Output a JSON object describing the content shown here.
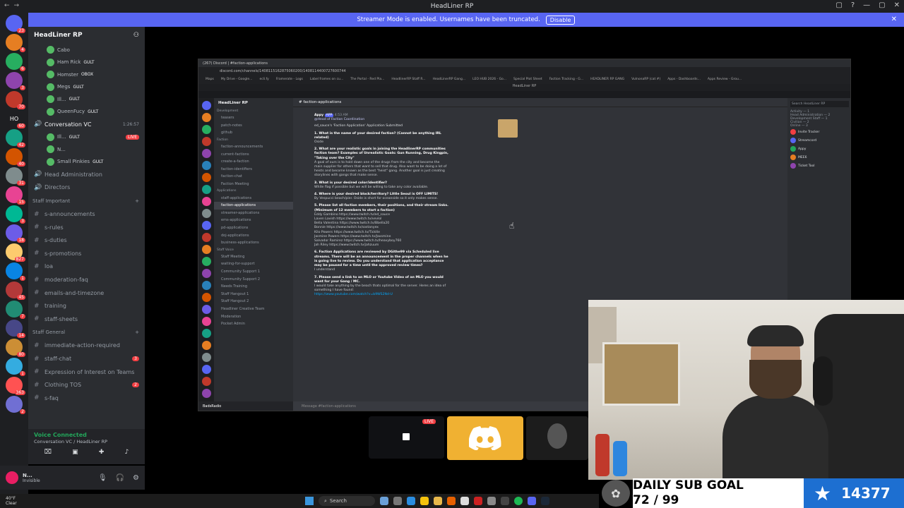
{
  "window": {
    "title": "HeadLiner RP",
    "nav": [
      "←",
      "→"
    ],
    "controls": [
      "▢",
      "?",
      "—",
      "▢",
      "✕"
    ]
  },
  "streamer_banner": {
    "text": "Streamer Mode is enabled. Usernames have been truncated.",
    "button": "Disable"
  },
  "guilds": {
    "badges": [
      "23",
      "4",
      "6",
      "3",
      "70",
      "60",
      "42",
      "40",
      "31",
      "15",
      "3",
      "18",
      "827",
      "1",
      "45",
      "7",
      "14",
      "80",
      "1",
      "363",
      "2"
    ],
    "home_label": "HO"
  },
  "server": {
    "name": "HeadLiner RP",
    "voice_users": [
      "Cabo",
      "Ham Rick",
      "Homster",
      "Megs",
      "Ill...",
      "QueenFucy"
    ],
    "voice_tags": [
      "",
      "GULT",
      "OBOX",
      "GULT",
      "GULT",
      "GULT"
    ],
    "voice_channel": "Conversation VC",
    "voice_channel_time": "1:26:57",
    "conv_users": [
      "Ill...",
      "N...",
      "Small Pinkies"
    ],
    "conv_tags": [
      "GULT",
      "",
      "GULT"
    ],
    "live_label": "LIVE",
    "channels_top": [
      "Head Administration",
      "Directors"
    ],
    "category_staff_important": "Staff Important",
    "staff_channels": [
      {
        "name": "s-announcements",
        "badge": ""
      },
      {
        "name": "s-rules",
        "badge": ""
      },
      {
        "name": "s-duties",
        "badge": ""
      },
      {
        "name": "s-promotions",
        "badge": ""
      },
      {
        "name": "loa",
        "badge": ""
      },
      {
        "name": "moderation-faq",
        "badge": ""
      },
      {
        "name": "emails-and-timezone",
        "badge": ""
      },
      {
        "name": "training",
        "badge": ""
      },
      {
        "name": "staff-sheets",
        "badge": ""
      }
    ],
    "category_staff_general": "Staff General",
    "general_channels": [
      {
        "name": "immediate-action-required",
        "badge": ""
      },
      {
        "name": "staff-chat",
        "badge": "3"
      },
      {
        "name": "Expression of Interest on Teams",
        "badge": ""
      },
      {
        "name": "Clothing TOS",
        "badge": "2"
      },
      {
        "name": "s-faq",
        "badge": ""
      }
    ]
  },
  "voice_status": {
    "title": "Voice Connected",
    "subtitle": "Conversation VC / HeadLiner RP"
  },
  "user": {
    "name": "N...",
    "status": "Invisible"
  },
  "shared_screen": {
    "tab_title": "(267) Discord | #faction-applications",
    "address": "discord.com/channels/1408115162875060200/1408114400727600744",
    "bookmarks": [
      "Maps",
      "My Drive - Google...",
      "ecli.fy",
      "Framerate - Logs",
      "Label frames on cu...",
      "The Portal - Red Pla...",
      "HeadlinerRP Staff R...",
      "HeadLinerRP Gang...",
      "LEO HUB 2026 - Go...",
      "Special Plot Sheet",
      "Faction Tracking - G...",
      "HEADLINER RP GANG",
      "VulnonaRP (cat #)",
      "Apps - Dashboards...",
      "Apps Review - Grou..."
    ],
    "window_label": "HeadLiner RP",
    "server_name": "HeadLiner RP",
    "channel_name": "faction-applications",
    "categories": [
      "Development",
      "Faction",
      "Applications",
      "Staff Voice"
    ],
    "dev_channels": [
      "teasers",
      "patch-notes",
      "github"
    ],
    "faction_channels": [
      "faction-announcements",
      "current-factions",
      "create-a-faction",
      "faction-identifiers",
      "faction-chat",
      "Faction Meeting"
    ],
    "app_channels": [
      "staff-applications",
      "faction-applications",
      "streamer-applications",
      "ems-applications",
      "pd-applications",
      "doj-applications",
      "business-applications"
    ],
    "voice_channels": [
      "Staff Meeting",
      "waiting-for-support",
      "Community Support 1",
      "Community Support 2",
      "Needs Training",
      "Staff Hangout 1",
      "Staff Hangout 2",
      "Headliner Creative Team",
      "Moderation",
      "Pocket Admin"
    ],
    "message": {
      "author": "Appy",
      "bot_tag": "APP",
      "time": "4:53 AM",
      "role_ping": "@Head of Faction Coordination",
      "header": "ed_sauce's 'Faction Application' Application Submitted",
      "q1": "1. What is the name of your desired faction? (Cannot be anything IRL related)",
      "a1": "Oside",
      "q2": "2. What are your realistic goals in joining the HeadlinerRP communities faction team? Examples of Unrealistic Goals: Gun Running, Drug Kingpin, \"Taking over the City\"",
      "a2": "A goal of ours is to hold down one of the drugs from the city and become the main supplier for others that want to sell that drug. Also want to be doing a lot of heists and become known as the best \"heist\" gang. Another goal is just creating storylines with gangs that make sense.",
      "q3": "3. What is your desired color/identifier?",
      "a3": "White flag if possible but we will be willing to take any color available.",
      "q4": "4. Where is your desired block/territory? Little Seoul is OFF LIMITS!",
      "a4": "By Vespucci beach/pier. Oside is short for oceanside so it only makes sense.",
      "q5": "5. Please list all faction members, their positions, and their stream links. (Minimum of 12 members to start a faction)",
      "a5": [
        "Eddy Gambino https://www.twitch.tv/ed_sauce",
        "Laven Lavish https://www.twitch.tv/vevlol",
        "Bella Valentina https://www.twitch.tv/Bbella20",
        "Bonnie https://www.twitch.tv/sostanyex",
        "Kilo Powers https://www.twitch.tv/Ticktle",
        "Jasmine Powers https://www.twitch.tv/Jaxsmine",
        "Salvador Ramirez https://www.twitch.tv/heavyboy760",
        "Jah Riley https://www.twitch.tv/jahzuum"
      ],
      "q6": "6. Faction Applications are reviewed by DGithe99 via Scheduled live streams. There will be an announcement in the proper channels when he is going live to review. Do you understand that application acceptance may be paused for a time until the approved review times?",
      "a6": "I understand",
      "q7": "7. Please send a link to an MLO or Youtube Video of an MLO you would want for your Gang / MC.",
      "a7": "I would take anything by the beach thats optimal for the server. Heres an idea of something I have found:",
      "a7link": "https://www.youtube.com/watch?v=b9WS2Nd-U"
    },
    "input_placeholder": "Message #faction-applications",
    "search_placeholder": "Search HeadLiner RP",
    "member_groups": [
      "Activity — 1",
      "Head Administration — 2",
      "Development Staff — 1",
      "Civilian — 2",
      "Online — 3"
    ],
    "members": [
      "Invite Tracker",
      "Streamcord",
      "Appy",
      "MEE6",
      "Ticket Tool"
    ],
    "user_label": "BadsRadio"
  },
  "stream_tiles": {
    "live_label": "LIVE"
  },
  "sub_goal": {
    "title": "DAILY SUB GOAL",
    "progress": "72 / 99",
    "current": 72,
    "target": 99,
    "count": "14377"
  },
  "taskbar": {
    "weather_temp": "40°F",
    "weather_desc": "Clear",
    "search_placeholder": "Search"
  },
  "colors": {
    "blurple": "#5865f2",
    "live_red": "#f23f43",
    "online_green": "#23a55a",
    "goal_blue": "#1d6fd1",
    "discord_tile": "#f0b132"
  }
}
